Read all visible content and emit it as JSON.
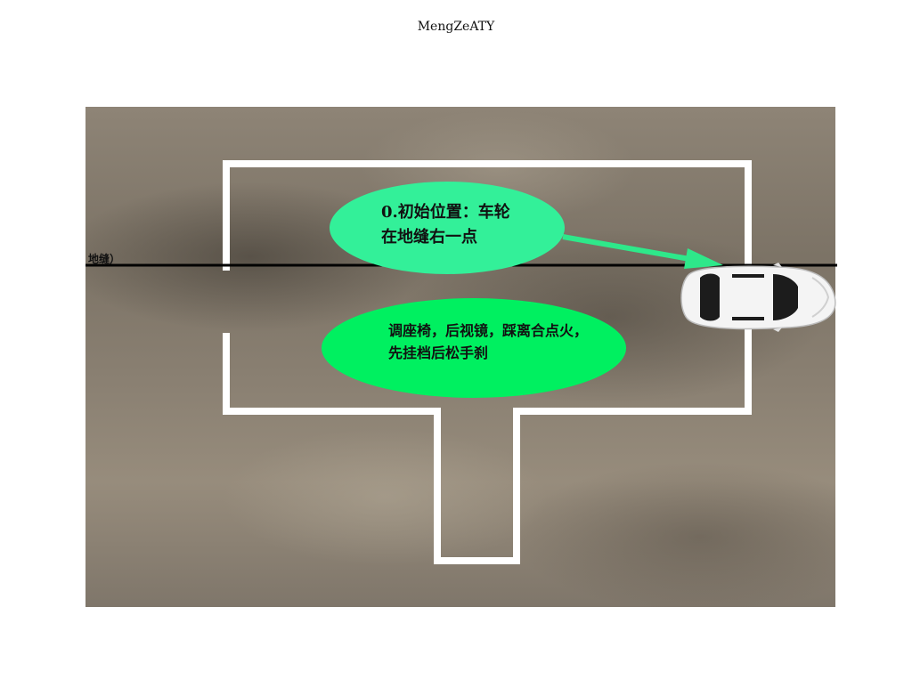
{
  "header": {
    "title": "MengZeATY"
  },
  "labels": {
    "ground_crack": "地缝）"
  },
  "bubbles": [
    {
      "line1": "0.初始位置：车轮",
      "line2": "在地缝右一点",
      "color": "#33f099"
    },
    {
      "line1": "调座椅，后视镜，踩离合点火，",
      "line2": "先挂档后松手刹",
      "color": "#00f060"
    }
  ],
  "colors": {
    "ground": "#877d70",
    "boundary_line": "#ffffff",
    "crack_line": "#000000",
    "arrow": "#2ee88a",
    "car_body": "#f4f4f4"
  },
  "icons": {
    "car": "car-icon"
  }
}
